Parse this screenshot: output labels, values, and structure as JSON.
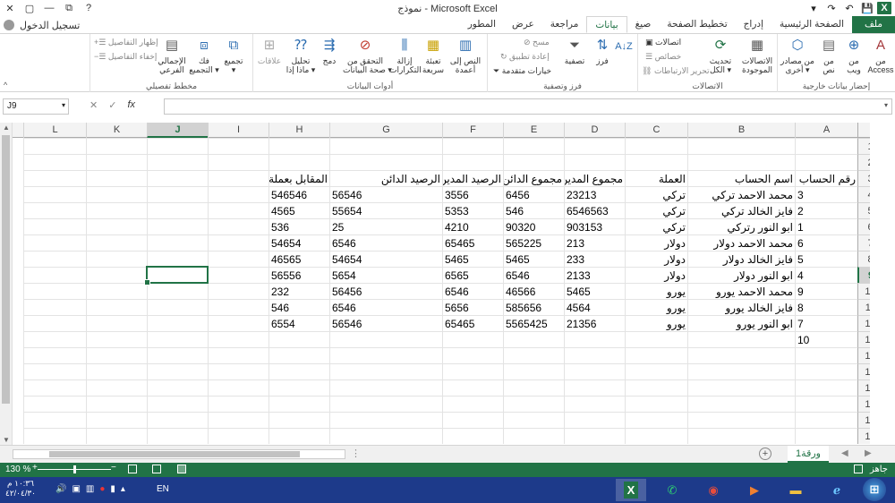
{
  "window": {
    "title": "نموذج - Microsoft Excel",
    "controls": [
      "✕",
      "▢",
      "—",
      "⧉",
      "?"
    ]
  },
  "qat": {
    "app_badge": "X",
    "save": "💾",
    "undo": "↶",
    "redo": "↷",
    "customize": "▾"
  },
  "signin": "تسجيل الدخول",
  "tabs": [
    {
      "label": "ملف",
      "kind": "file"
    },
    {
      "label": "الصفحة الرئيسية"
    },
    {
      "label": "إدراج"
    },
    {
      "label": "تخطيط الصفحة"
    },
    {
      "label": "صيغ"
    },
    {
      "label": "بيانات",
      "active": true
    },
    {
      "label": "مراجعة"
    },
    {
      "label": "عرض"
    },
    {
      "label": "المطور"
    }
  ],
  "ribbon": {
    "group_external": "إحضار بيانات خارجية",
    "btn_access": "من\nAccess",
    "btn_web": "من\nويب",
    "btn_text": "من\nنص",
    "btn_other": "من مصادر\nأخرى ▾",
    "btn_existing": "الاتصالات\nالموجودة",
    "group_connections": "الاتصالات",
    "btn_refresh": "تحديث\nالكل ▾",
    "conn_connections": "اتصالات",
    "conn_properties": "خصائص",
    "conn_edit_links": "تحرير الارتباطات",
    "group_sort": "فرز وتصفية",
    "btn_sort": "فرز",
    "btn_filter": "تصفية",
    "sort_clear": "مسح",
    "sort_reapply": "إعادة تطبيق",
    "sort_advanced": "خيارات متقدمة",
    "group_tools": "أدوات البيانات",
    "btn_text_to_columns": "النص إلى\nأعمدة",
    "btn_flash_fill": "تعبئة\nسريعة",
    "btn_remove_dup": "إزالة\nالتكرارات",
    "btn_validation": "التحقق من\nصحة البيانات ▾",
    "btn_consolidate": "دمج",
    "btn_whatif": "تحليل\nماذا إذا ▾",
    "btn_relationships": "علاقات",
    "group_outline": "مخطط تفصيلي",
    "btn_group": "تجميع\n▾",
    "btn_ungroup": "فك\nالتجميع ▾",
    "btn_subtotal": "الإجمالي\nالفرعي",
    "outline_show": "إظهار التفاصيل",
    "outline_hide": "إخفاء التفاصيل"
  },
  "formula_bar": {
    "name_box": "J9",
    "fx": "fx",
    "cancel": "✕",
    "enter": "✓",
    "content": ""
  },
  "columns": [
    "A",
    "B",
    "C",
    "D",
    "E",
    "F",
    "G",
    "H",
    "I",
    "J",
    "K",
    "L"
  ],
  "selected_column": "J",
  "selected_row": 9,
  "selected_cell": "J9",
  "rows": [
    {
      "n": 1,
      "cells": {}
    },
    {
      "n": 2,
      "cells": {}
    },
    {
      "n": 3,
      "cells": {
        "A": "رقم الحساب",
        "B": "اسم الحساب",
        "C": "العملة",
        "D": "مجموع المدين",
        "E": "مجموع الدائن",
        "F": "الرصيد المدين",
        "G": "الرصيد الدائن",
        "H": "المقابل بعملة الاساس"
      }
    },
    {
      "n": 4,
      "cells": {
        "A": "3",
        "B": "محمد الاحمد تركي",
        "C": "تركي",
        "D": "23213",
        "E": "6456",
        "F": "3556",
        "G": "56546",
        "H": "546546"
      }
    },
    {
      "n": 5,
      "cells": {
        "A": "2",
        "B": "فايز الخالد تركي",
        "C": "تركي",
        "D": "6546563",
        "E": "546",
        "F": "5353",
        "G": "55654",
        "H": "4565"
      }
    },
    {
      "n": 6,
      "cells": {
        "A": "1",
        "B": "ابو النور رتركي",
        "C": "تركي",
        "D": "903153",
        "E": "90320",
        "F": "4210",
        "G": "25",
        "H": "536"
      }
    },
    {
      "n": 7,
      "cells": {
        "A": "6",
        "B": "محمد الاحمد دولار",
        "C": "دولار",
        "D": "213",
        "E": "565225",
        "F": "65465",
        "G": "6546",
        "H": "54654"
      }
    },
    {
      "n": 8,
      "cells": {
        "A": "5",
        "B": "فايز الخالد دولار",
        "C": "دولار",
        "D": "233",
        "E": "5465",
        "F": "5465",
        "G": "54654",
        "H": "46565"
      }
    },
    {
      "n": 9,
      "cells": {
        "A": "4",
        "B": "ابو النور دولار",
        "C": "دولار",
        "D": "2133",
        "E": "6546",
        "F": "6565",
        "G": "5654",
        "H": "56556"
      }
    },
    {
      "n": 10,
      "cells": {
        "A": "9",
        "B": "محمد الاحمد يورو",
        "C": "يورو",
        "D": "5465",
        "E": "46566",
        "F": "6546",
        "G": "56456",
        "H": "232"
      }
    },
    {
      "n": 11,
      "cells": {
        "A": "8",
        "B": "فايز الخالد يورو",
        "C": "يورو",
        "D": "4564",
        "E": "585656",
        "F": "5656",
        "G": "6546",
        "H": "546"
      }
    },
    {
      "n": 12,
      "cells": {
        "A": "7",
        "B": "ابو النور يورو",
        "C": "يورو",
        "D": "21356",
        "E": "5565425",
        "F": "65465",
        "G": "56546",
        "H": "6554"
      }
    },
    {
      "n": 13,
      "cells": {
        "A": "10"
      }
    },
    {
      "n": 14,
      "cells": {}
    },
    {
      "n": 15,
      "cells": {}
    },
    {
      "n": 16,
      "cells": {}
    },
    {
      "n": 17,
      "cells": {}
    },
    {
      "n": 18,
      "cells": {}
    },
    {
      "n": 19,
      "cells": {}
    }
  ],
  "sheet": {
    "tab": "ورقة1",
    "add": "+"
  },
  "status": {
    "ready": "جاهز",
    "zoom": "130 %"
  },
  "taskbar": {
    "time": "١٠:٣٦ م",
    "date": "٤٢/٠٤/٣٠",
    "lang": "EN",
    "apps": [
      "start",
      "ie",
      "explorer",
      "media",
      "chrome",
      "whatsapp",
      "excel"
    ]
  }
}
